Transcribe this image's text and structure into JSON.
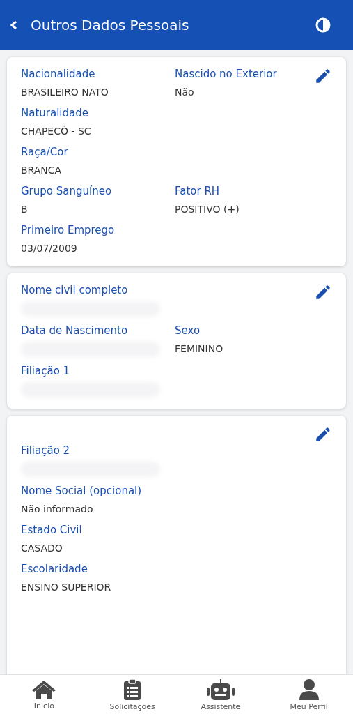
{
  "header": {
    "title": "Outros Dados Pessoais"
  },
  "cards": [
    {
      "kind": "inline_edit",
      "rows": [
        [
          {
            "label": "Nacionalidade",
            "value": "BRASILEIRO NATO"
          },
          {
            "label": "Nascido no Exterior",
            "value": "Não"
          }
        ],
        [
          {
            "label": "Naturalidade",
            "value": "CHAPECÓ - SC"
          }
        ],
        [
          {
            "label": "Raça/Cor",
            "value": "BRANCA"
          }
        ],
        [
          {
            "label": "Grupo Sanguíneo",
            "value": "B"
          },
          {
            "label": "Fator RH",
            "value": "POSITIVO (+)"
          }
        ],
        [
          {
            "label": "Primeiro Emprego",
            "value": "03/07/2009"
          }
        ]
      ]
    },
    {
      "kind": "inline_edit",
      "rows": [
        [
          {
            "label": "Nome civil completo",
            "redacted": true
          }
        ],
        [
          {
            "label": "Data de Nascimento",
            "redacted": true
          },
          {
            "label": "Sexo",
            "value": "FEMININO"
          }
        ],
        [
          {
            "label": "Filiação 1",
            "redacted": true
          }
        ]
      ]
    },
    {
      "kind": "top_edit",
      "rows": [
        [
          {
            "label": "Filiação 2",
            "redacted": true
          }
        ],
        [
          {
            "label": "Nome Social (opcional)",
            "value": "Não informado"
          }
        ],
        [
          {
            "label": "Estado Civil",
            "value": "CASADO"
          }
        ],
        [
          {
            "label": "Escolaridade",
            "value": "ENSINO SUPERIOR"
          }
        ]
      ]
    }
  ],
  "nav": [
    {
      "kind": "home",
      "label": "Inicio"
    },
    {
      "kind": "clipboard",
      "label": "Solicitações"
    },
    {
      "kind": "robot",
      "label": "Assistente"
    },
    {
      "kind": "person",
      "label": "Meu Perfil"
    }
  ]
}
